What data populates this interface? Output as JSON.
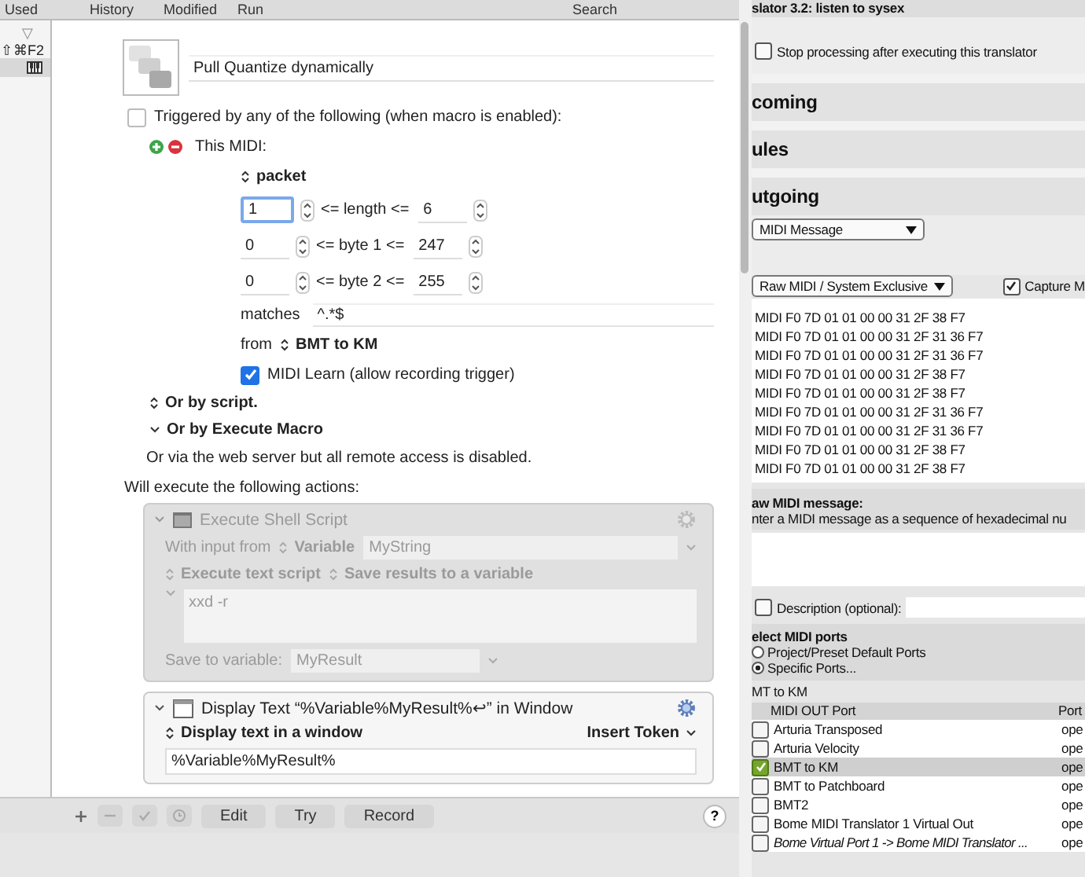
{
  "macro_editor": {
    "header_columns": [
      "Used",
      "History",
      "Modified",
      "Run",
      "Search"
    ],
    "sidebar": {
      "collapse_glyph": "▽",
      "hotkey": "⇧⌘F2"
    },
    "macro_name": "Pull Quantize dynamically",
    "trigger_header": {
      "label": "Triggered by any of the following (when macro is enabled):",
      "checked": false
    },
    "midi_trigger": {
      "label": "This MIDI:",
      "packet_label": "packet",
      "ranges": [
        {
          "min": "1",
          "label": "<= length <=",
          "max": "6",
          "focused": true
        },
        {
          "min": "0",
          "label": "<= byte 1 <=",
          "max": "247",
          "focused": false
        },
        {
          "min": "0",
          "label": "<= byte 2 <=",
          "max": "255",
          "focused": false
        }
      ],
      "matches_label": "matches",
      "matches_value": "^.*$",
      "from_label": "from",
      "source": "BMT to KM",
      "learn": {
        "label": "MIDI Learn (allow recording trigger)",
        "checked": true
      }
    },
    "other_triggers": [
      {
        "label": "Or by script.",
        "kind": "popup"
      },
      {
        "label": "Or by Execute Macro",
        "kind": "disclosure"
      }
    ],
    "web_note": "Or via the web server but all remote access is disabled.",
    "actions_heading": "Will execute the following actions:",
    "shell_action": {
      "title": "Execute Shell Script",
      "disabled": true,
      "input_label": "With input from",
      "input_source": "Variable",
      "input_variable": "MyString",
      "mode": "Execute text script",
      "output": "Save results to a variable",
      "script": "xxd -r",
      "save_label": "Save to variable:",
      "save_variable": "MyResult"
    },
    "display_action": {
      "title": "Display Text “%Variable%MyResult%↩” in Window",
      "disabled": false,
      "mode": "Display text in a window",
      "insert_token": "Insert Token",
      "text": "%Variable%MyResult%"
    },
    "toolbar": {
      "buttons": [
        "Edit",
        "Try",
        "Record"
      ],
      "help": "?"
    }
  },
  "bome": {
    "title_fragment": "slator 3.2: listen to sysex",
    "stop_processing": {
      "label": "Stop processing after executing this translator",
      "checked": false
    },
    "sections": [
      "coming",
      "ules",
      "utgoing"
    ],
    "action_type": "MIDI Message",
    "message_type": "Raw MIDI / System Exclusive",
    "capture": {
      "label": "Capture M",
      "checked": true
    },
    "log": [
      "MIDI F0 7D 01 01 00 00 31 2F 38 F7",
      "MIDI F0 7D 01 01 00 00 31 2F 31 36 F7",
      "MIDI F0 7D 01 01 00 00 31 2F 31 36 F7",
      "MIDI F0 7D 01 01 00 00 31 2F 38 F7",
      "MIDI F0 7D 01 01 00 00 31 2F 38 F7",
      "MIDI F0 7D 01 01 00 00 31 2F 31 36 F7",
      "MIDI F0 7D 01 01 00 00 31 2F 31 36 F7",
      "MIDI F0 7D 01 01 00 00 31 2F 38 F7",
      "MIDI F0 7D 01 01 00 00 31 2F 38 F7"
    ],
    "raw_heading": "aw MIDI message:",
    "raw_hint": "nter a MIDI message as a sequence of hexadecimal nu",
    "description": {
      "label": "Description (optional):",
      "checked": false
    },
    "ports_heading": "elect MIDI ports",
    "port_modes": [
      {
        "label": "Project/Preset Default Ports",
        "selected": false
      },
      {
        "label": "Specific Ports...",
        "selected": true
      }
    ],
    "port_group": "MT to KM",
    "columns": [
      "MIDI OUT Port",
      "Port"
    ],
    "ports": [
      {
        "name": "Arturia Transposed",
        "status": "ope",
        "checked": false,
        "selected": false,
        "kind": "device"
      },
      {
        "name": "Arturia Velocity",
        "status": "ope",
        "checked": false,
        "selected": false,
        "kind": "device"
      },
      {
        "name": "BMT to KM",
        "status": "ope",
        "checked": true,
        "selected": true,
        "kind": "device"
      },
      {
        "name": "BMT to Patchboard",
        "status": "ope",
        "checked": false,
        "selected": false,
        "kind": "device"
      },
      {
        "name": "BMT2",
        "status": "ope",
        "checked": false,
        "selected": false,
        "kind": "device"
      },
      {
        "name": "Bome MIDI Translator 1 Virtual Out",
        "status": "ope",
        "checked": false,
        "selected": false,
        "kind": "device"
      },
      {
        "name": "Bome Virtual Port 1 -> Bome MIDI Translator ...",
        "status": "ope",
        "checked": false,
        "selected": false,
        "kind": "virtual"
      }
    ]
  }
}
